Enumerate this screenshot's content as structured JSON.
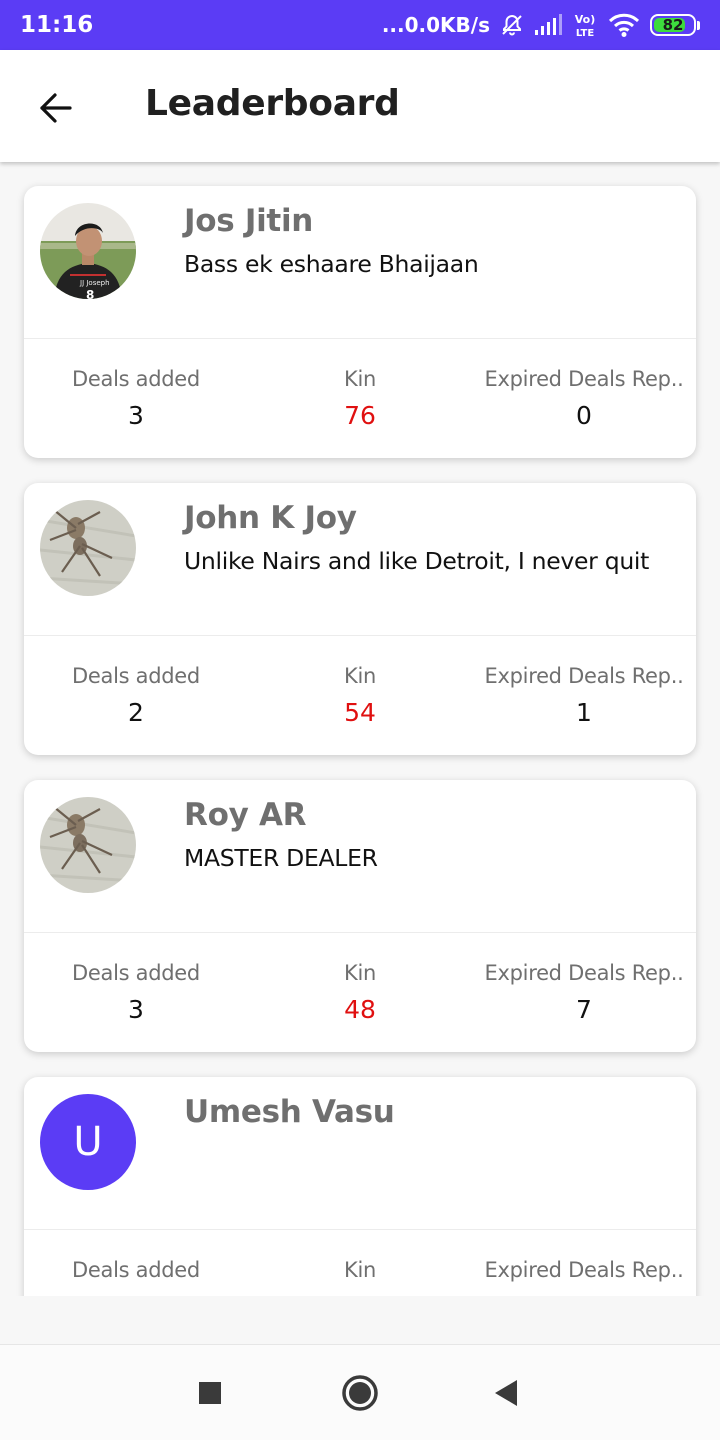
{
  "status_bar": {
    "time": "11:16",
    "speed": "...0.0KB/s",
    "battery": "82",
    "battery_level": 0.82,
    "colors": {
      "background": "#5b3cf5",
      "battery": "#3ddc3d"
    },
    "icons": [
      "dnd-off-icon",
      "signal-icon",
      "volte-icon",
      "wifi-icon",
      "battery-icon"
    ]
  },
  "app_bar": {
    "title": "Leaderboard",
    "back_icon": "arrow-left-icon"
  },
  "leaderboard": [
    {
      "name": "Jos Jitin",
      "tagline": "Bass ek eshaare Bhaijaan",
      "avatar": "photo",
      "stats": [
        {
          "label": "Deals added",
          "value": "3"
        },
        {
          "label": "Kin",
          "value": "76"
        },
        {
          "label": "Expired Deals Rep..",
          "value": "0"
        }
      ]
    },
    {
      "name": "John K Joy",
      "tagline": "Unlike Nairs and like Detroit, I never quit",
      "avatar": "photo",
      "stats": [
        {
          "label": "Deals added",
          "value": "2"
        },
        {
          "label": "Kin",
          "value": "54"
        },
        {
          "label": "Expired Deals Rep..",
          "value": "1"
        }
      ]
    },
    {
      "name": "Roy AR",
      "tagline": "MASTER DEALER",
      "avatar": "photo",
      "stats": [
        {
          "label": "Deals added",
          "value": "3"
        },
        {
          "label": "Kin",
          "value": "48"
        },
        {
          "label": "Expired Deals Rep..",
          "value": "7"
        }
      ]
    },
    {
      "name": "Umesh Vasu",
      "tagline": "",
      "avatar": "U",
      "stats": [
        {
          "label": "Deals added",
          "value": ""
        },
        {
          "label": "Kin",
          "value": ""
        },
        {
          "label": "Expired Deals Rep..",
          "value": ""
        }
      ]
    }
  ],
  "colors": {
    "kin_value": "#e01010",
    "avatar_letter_bg": "#5b3cf5",
    "name_text": "#6f6f6f"
  },
  "nav_bar": {
    "icons": [
      "recents-square-icon",
      "home-circle-icon",
      "back-triangle-icon"
    ]
  }
}
